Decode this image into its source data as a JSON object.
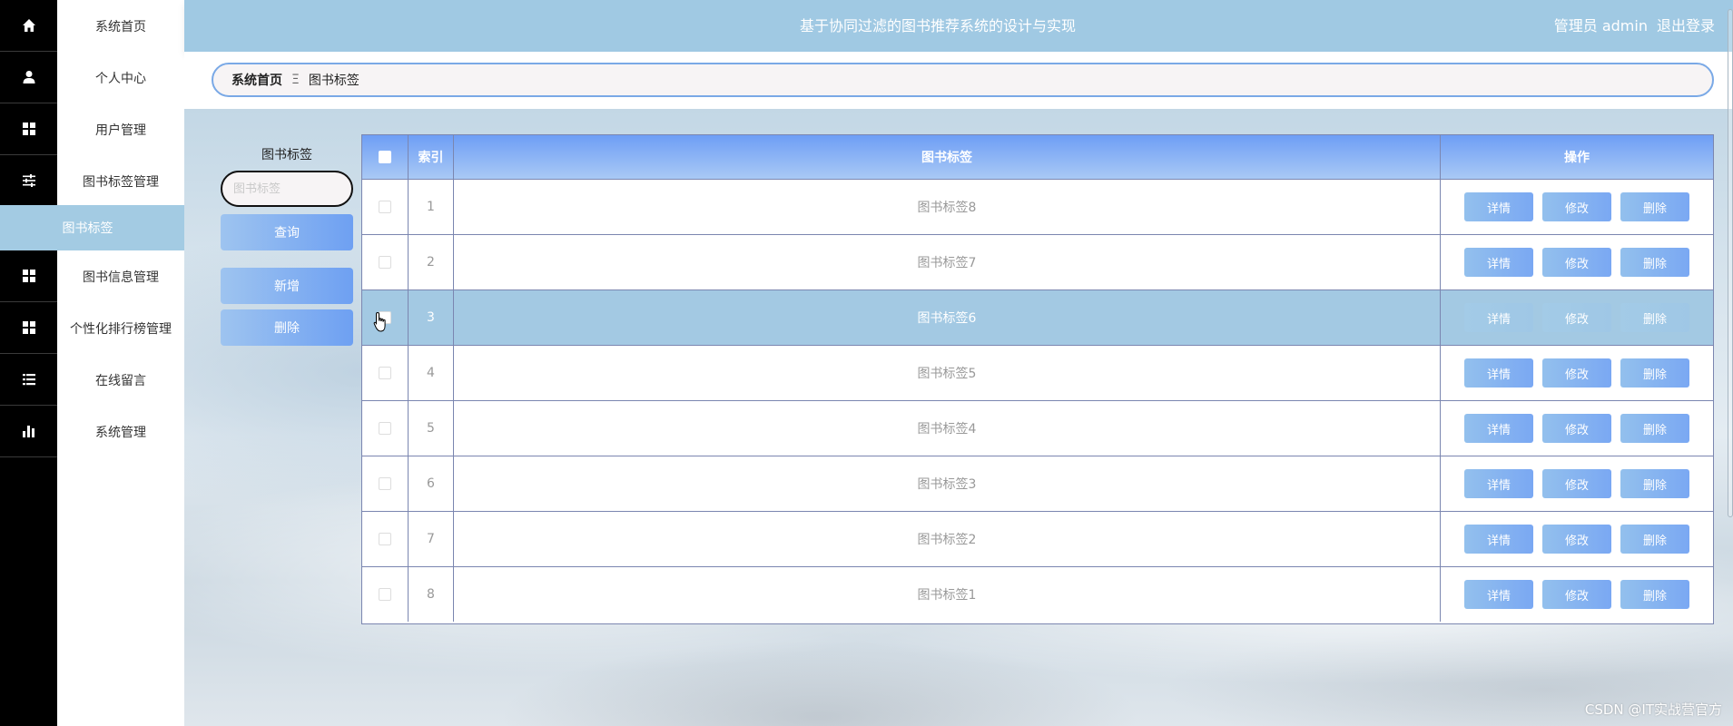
{
  "header": {
    "title": "基于协同过滤的图书推荐系统的设计与实现",
    "user_label": "管理员 admin",
    "logout_label": "退出登录"
  },
  "sidebar": {
    "items": [
      {
        "label": "系统首页",
        "icon": "home-icon"
      },
      {
        "label": "个人中心",
        "icon": "user-icon"
      },
      {
        "label": "用户管理",
        "icon": "grid-icon"
      },
      {
        "label": "图书标签管理",
        "icon": "sliders-icon"
      },
      {
        "label": "图书信息管理",
        "icon": "grid-icon"
      },
      {
        "label": "个性化排行榜管理",
        "icon": "grid-icon"
      },
      {
        "label": "在线留言",
        "icon": "list-icon"
      },
      {
        "label": "系统管理",
        "icon": "bar-chart-icon"
      }
    ],
    "active_sub": "图书标签"
  },
  "breadcrumb": {
    "home": "系统首页",
    "separator": "Ξ",
    "current": "图书标签"
  },
  "search": {
    "label": "图书标签",
    "placeholder": "图书标签",
    "query_label": "查询",
    "add_label": "新增",
    "delete_label": "删除"
  },
  "table": {
    "columns": [
      "索引",
      "图书标签",
      "操作"
    ],
    "action_labels": {
      "detail": "详情",
      "edit": "修改",
      "delete": "删除"
    },
    "rows": [
      {
        "index": "1",
        "tag": "图书标签8"
      },
      {
        "index": "2",
        "tag": "图书标签7"
      },
      {
        "index": "3",
        "tag": "图书标签6"
      },
      {
        "index": "4",
        "tag": "图书标签5"
      },
      {
        "index": "5",
        "tag": "图书标签4"
      },
      {
        "index": "6",
        "tag": "图书标签3"
      },
      {
        "index": "7",
        "tag": "图书标签2"
      },
      {
        "index": "8",
        "tag": "图书标签1"
      }
    ],
    "highlighted_row": 3
  },
  "watermark": "CSDN @IT实战营官方",
  "colors": {
    "header_bg": "#a0c9e3",
    "active_bg": "#a3cbe3",
    "button_start": "#9ec4f0",
    "button_end": "#6ea0f2",
    "table_head": "#6e9ef5"
  }
}
